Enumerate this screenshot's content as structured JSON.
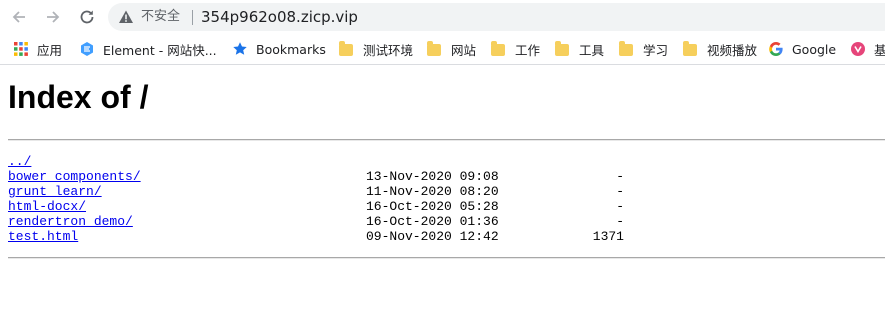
{
  "browser": {
    "security_label": "不安全",
    "url": "354p962o08.zicp.vip"
  },
  "bookmarks": [
    {
      "label": "应用",
      "icon": "apps-grid-icon"
    },
    {
      "label": "Element - 网站快...",
      "icon": "element-logo-icon"
    },
    {
      "label": "Bookmarks",
      "icon": "star-icon"
    },
    {
      "label": "测试环境",
      "icon": "folder-icon"
    },
    {
      "label": "网站",
      "icon": "folder-icon"
    },
    {
      "label": "工作",
      "icon": "folder-icon"
    },
    {
      "label": "工具",
      "icon": "folder-icon"
    },
    {
      "label": "学习",
      "icon": "folder-icon"
    },
    {
      "label": "视频播放",
      "icon": "folder-icon"
    },
    {
      "label": "Google",
      "icon": "google-g-icon"
    },
    {
      "label": "基",
      "icon": "pink-logo-icon"
    }
  ],
  "page": {
    "title": "Index of /",
    "parent_link": "../",
    "entries": [
      {
        "name": "bower_components/",
        "date": "13-Nov-2020 09:08",
        "size": "-"
      },
      {
        "name": "grunt_learn/",
        "date": "11-Nov-2020 08:20",
        "size": "-"
      },
      {
        "name": "html-docx/",
        "date": "16-Oct-2020 05:28",
        "size": "-"
      },
      {
        "name": "rendertron_demo/",
        "date": "16-Oct-2020 01:36",
        "size": "-"
      },
      {
        "name": "test.html",
        "date": "09-Nov-2020 12:42",
        "size": "1371"
      }
    ]
  },
  "colors": {
    "link": "#0000ee",
    "omnibox_bg": "#f1f3f4",
    "folder": "#f6cf5c"
  }
}
